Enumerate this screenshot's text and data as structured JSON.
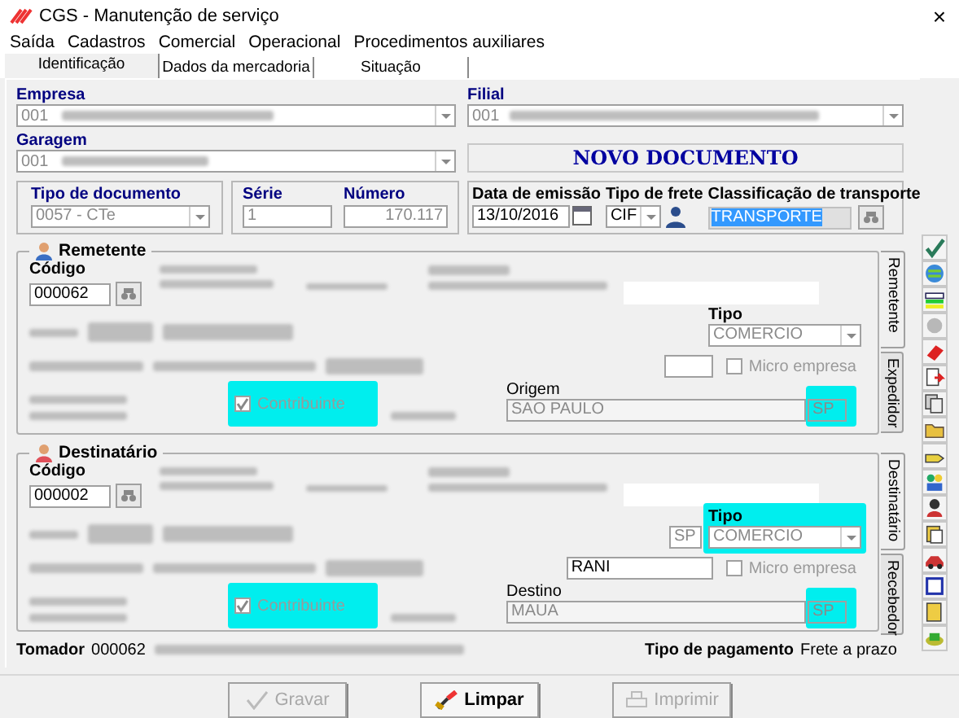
{
  "window": {
    "title": "CGS - Manutenção de serviço",
    "close": "×"
  },
  "menu": [
    "Saída",
    "Cadastros",
    "Comercial",
    "Operacional",
    "Procedimentos auxiliares"
  ],
  "tabs": [
    {
      "label": "Identificação",
      "selected": true
    },
    {
      "label": "Dados da mercadoria",
      "selected": false
    },
    {
      "label": "Situação",
      "selected": false
    }
  ],
  "empresa": {
    "label": "Empresa",
    "value": "001"
  },
  "filial": {
    "label": "Filial",
    "value": "001"
  },
  "garagem": {
    "label": "Garagem",
    "value": "001"
  },
  "banner": "NOVO DOCUMENTO",
  "tipo_documento": {
    "label": "Tipo de documento",
    "value": "0057 - CTe"
  },
  "serie": {
    "label": "Série",
    "value": "1"
  },
  "numero": {
    "label": "Número",
    "value": "170.117"
  },
  "data_emissao": {
    "label": "Data de emissão",
    "value": "13/10/2016"
  },
  "tipo_frete": {
    "label": "Tipo de frete",
    "value": "CIF"
  },
  "classificacao": {
    "label": "Classificação de transporte",
    "value": "TRANSPORTE",
    "selected": true
  },
  "parties": [
    {
      "title": "Remetente",
      "color": "#3a6fc4",
      "codigo_label": "Código",
      "codigo": "000062",
      "tipo_label": "Tipo",
      "tipo": "COMERCIO",
      "tipo_highlighted": false,
      "micro_empresa": {
        "label": "Micro empresa",
        "checked": false
      },
      "contribuinte": {
        "label": "Contribuinte",
        "checked": true,
        "highlighted": true
      },
      "local_label": "Origem",
      "local": "SAO PAULO",
      "uf": "SP",
      "uf_highlighted": true,
      "side_tabs": [
        {
          "label": "Remetente",
          "selected": true
        },
        {
          "label": "Expedidor",
          "selected": false
        }
      ]
    },
    {
      "title": "Destinatário",
      "color": "#e0505a",
      "codigo_label": "Código",
      "codigo": "000002",
      "uf_small": "SP",
      "tipo_label": "Tipo",
      "tipo": "COMERCIO",
      "tipo_highlighted": true,
      "extra": "RANI",
      "micro_empresa": {
        "label": "Micro empresa",
        "checked": false
      },
      "contribuinte": {
        "label": "Contribuinte",
        "checked": true,
        "highlighted": true
      },
      "local_label": "Destino",
      "local": "MAUA",
      "uf": "SP",
      "uf_highlighted": true,
      "side_tabs": [
        {
          "label": "Destinatário",
          "selected": true
        },
        {
          "label": "Recebedor",
          "selected": false
        }
      ]
    }
  ],
  "tomador": {
    "label": "Tomador",
    "value": "000062"
  },
  "pagamento": {
    "label": "Tipo de pagamento",
    "value": "Frete a prazo"
  },
  "buttons": [
    {
      "label": "Gravar",
      "kind": "save",
      "disabled": true
    },
    {
      "label": "Limpar",
      "kind": "clear",
      "disabled": false
    },
    {
      "label": "Imprimir",
      "kind": "print",
      "disabled": true
    }
  ]
}
